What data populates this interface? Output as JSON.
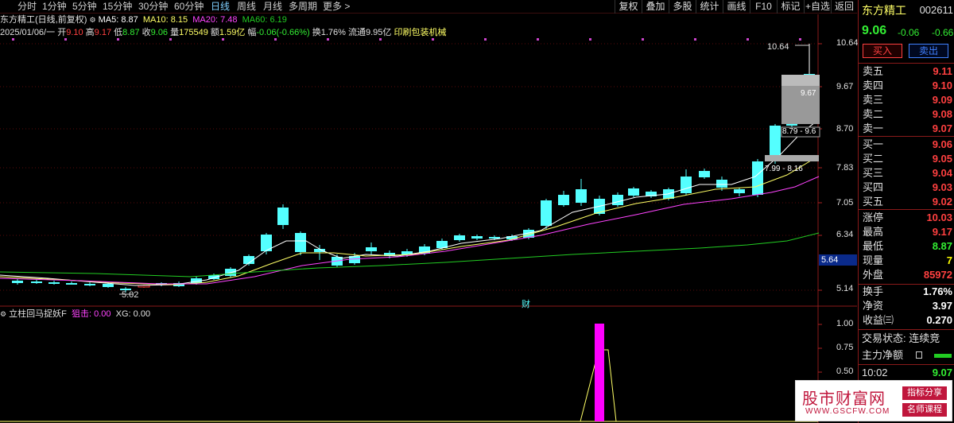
{
  "toolbar": {
    "tabs": [
      "分时",
      "1分钟",
      "5分钟",
      "15分钟",
      "30分钟",
      "60分钟",
      "日线",
      "周线",
      "月线",
      "多周期",
      "更多 >"
    ],
    "active_tab": "日线",
    "right_buttons": [
      "复权",
      "叠加",
      "多股",
      "统计",
      "画线",
      "F10",
      "标记",
      "+自选",
      "返回"
    ]
  },
  "legend": {
    "title": "东方精工(日线,前复权)",
    "ma5_label": "MA5: 8.87",
    "ma10_label": "MA10: 8.15",
    "ma20_label": "MA20: 7.48",
    "ma60_label": "MA60: 6.19"
  },
  "bar_info": {
    "date": "2025/01/06/一",
    "open_label": "开",
    "open": "9.10",
    "high_label": "高",
    "high": "9.17",
    "low_label": "低",
    "low": "8.87",
    "close_label": "收",
    "close": "9.06",
    "volume_label": "量",
    "volume": "175549",
    "amount_label": "额",
    "amount": "1.59亿",
    "change_label": "幅",
    "change": "-0.06(-0.66%)",
    "turnover": "换1.76%",
    "float_cap": "流通9.95亿",
    "industry": "印刷包装机械"
  },
  "price_axis": [
    "10.64",
    "9.67",
    "8.70",
    "7.83",
    "7.05",
    "6.34",
    "5.64",
    "5.14"
  ],
  "price_axis_highlight": "5.64",
  "chart_labels": {
    "high_mark": "10.64",
    "low_mark": "5.02",
    "box1": "9.67",
    "box2": "8.79 - 9.6",
    "box3": "7.99 - 8.16",
    "cai": "财"
  },
  "indicator": {
    "name": "立柱回马捉妖F",
    "ju_label": "狙击: 0.00",
    "xg_label": "XG: 0.00",
    "axis": [
      "1.00",
      "0.75",
      "0.50"
    ]
  },
  "sidebar": {
    "stock_name": "东方精工",
    "stock_code": "002611",
    "price": "9.06",
    "change": "-0.06",
    "change_pct": "-0.66",
    "buy_btn": "买入",
    "sell_btn": "卖出",
    "asks": [
      {
        "label": "卖五",
        "value": "9.11"
      },
      {
        "label": "卖四",
        "value": "9.10"
      },
      {
        "label": "卖三",
        "value": "9.09"
      },
      {
        "label": "卖二",
        "value": "9.08"
      },
      {
        "label": "卖一",
        "value": "9.07"
      }
    ],
    "bids": [
      {
        "label": "买一",
        "value": "9.06"
      },
      {
        "label": "买二",
        "value": "9.05"
      },
      {
        "label": "买三",
        "value": "9.04"
      },
      {
        "label": "买四",
        "value": "9.03"
      },
      {
        "label": "买五",
        "value": "9.02"
      }
    ],
    "stats": [
      {
        "label": "涨停",
        "value": "10.03",
        "color": "#ff4040"
      },
      {
        "label": "最高",
        "value": "9.17",
        "color": "#ff4040"
      },
      {
        "label": "最低",
        "value": "8.87",
        "color": "#33ee33"
      },
      {
        "label": "现量",
        "value": "7",
        "color": "#ffff00"
      },
      {
        "label": "外盘",
        "value": "85972",
        "color": "#ff4040"
      }
    ],
    "stats2": [
      {
        "label": "换手",
        "value": "1.76%",
        "color": "#ffffff"
      },
      {
        "label": "净资",
        "value": "3.97",
        "color": "#ffffff"
      },
      {
        "label": "收益㈢",
        "value": "0.270",
        "color": "#ffffff"
      }
    ],
    "trade_status": "交易状态: 连续竞",
    "main_flow": "主力净额",
    "tick_time": "10:02",
    "tick_price": "9.07"
  },
  "watermark": {
    "title": "股市财富网",
    "url": "WWW.GSCFW.COM",
    "tag1": "指标分享",
    "tag2": "名师课程"
  },
  "colors": {
    "up": "#ff3333",
    "down": "#54ffff",
    "ma5": "#ffffff",
    "ma10": "#ffff66",
    "ma20": "#ff44ff",
    "ma60": "#22cc22"
  }
}
